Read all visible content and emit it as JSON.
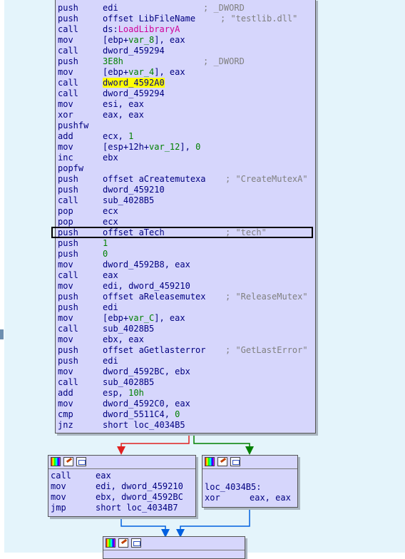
{
  "main_block": {
    "lines": [
      {
        "mn": "push",
        "op": "edi",
        "cm": "; _DWORD",
        "cmx": "cm1"
      },
      {
        "mn": "push",
        "op": "offset LibFileName",
        "cm": "; \"testlib.dll\"",
        "cmx": "cm2"
      },
      {
        "mn": "call",
        "op": "ds:",
        "op_mag": "LoadLibraryA"
      },
      {
        "mn": "mov",
        "op": "[ebp+",
        "op_green": "var_8",
        "op_tail": "], eax"
      },
      {
        "mn": "call",
        "op": "dword_459294"
      },
      {
        "mn": "push",
        "op_green_full": "3E8h",
        "cm": "; _DWORD",
        "cmx": "cm1"
      },
      {
        "mn": "mov",
        "op": "[ebp+",
        "op_green": "var_4",
        "op_tail": "], eax"
      },
      {
        "mn": "call",
        "op_hl": "dword_4592A0"
      },
      {
        "mn": "call",
        "op": "dword_459294"
      },
      {
        "mn": "mov",
        "op": "esi, eax"
      },
      {
        "mn": "xor",
        "op": "eax, eax"
      },
      {
        "mn": "pushfw",
        "op": ""
      },
      {
        "mn": "add",
        "op": "ecx, ",
        "op_green2": "1"
      },
      {
        "mn": "mov",
        "op": "[esp+12h+",
        "op_green": "var_12",
        "op_tail": "], ",
        "op_green3": "0"
      },
      {
        "mn": "inc",
        "op": "ebx"
      },
      {
        "mn": "popfw",
        "op": ""
      },
      {
        "mn": "push",
        "op": "offset aCreatemutexa",
        "cm": "; \"CreateMutexA\"",
        "cmx": "cm3"
      },
      {
        "mn": "push",
        "op": "dword_459210"
      },
      {
        "mn": "call",
        "op": "sub_4028B5"
      },
      {
        "mn": "pop",
        "op": "ecx"
      },
      {
        "mn": "pop",
        "op": "ecx"
      },
      {
        "mn": "push",
        "op": "offset aTech",
        "cm": "; \"tech\"",
        "cmx": "cm4"
      },
      {
        "mn": "push",
        "op_green_full": "1"
      },
      {
        "mn": "push",
        "op_green_full": "0"
      },
      {
        "mn": "mov",
        "op": "dword_4592B8, eax"
      },
      {
        "mn": "call",
        "op": "eax"
      },
      {
        "mn": "mov",
        "op": "edi, dword_459210"
      },
      {
        "mn": "push",
        "op": "offset aReleasemutex",
        "cm": "; \"ReleaseMutex\"",
        "cmx": "cm3"
      },
      {
        "mn": "push",
        "op": "edi"
      },
      {
        "mn": "mov",
        "op": "[ebp+",
        "op_green": "var_C",
        "op_tail": "], eax"
      },
      {
        "mn": "call",
        "op": "sub_4028B5"
      },
      {
        "mn": "mov",
        "op": "ebx, eax"
      },
      {
        "mn": "push",
        "op": "offset aGetlasterror",
        "cm": "; \"GetLastError\"",
        "cmx": "cm3"
      },
      {
        "mn": "push",
        "op": "edi"
      },
      {
        "mn": "mov",
        "op": "dword_4592BC, ebx"
      },
      {
        "mn": "call",
        "op": "sub_4028B5"
      },
      {
        "mn": "add",
        "op": "esp, ",
        "op_green2": "10h"
      },
      {
        "mn": "mov",
        "op": "dword_4592C0, eax"
      },
      {
        "mn": "cmp",
        "op": "dword_5511C4, ",
        "op_green3": "0"
      },
      {
        "mn": "jnz",
        "op": "short loc_4034B5"
      }
    ]
  },
  "block_a": {
    "lines": [
      {
        "mn": "call",
        "op": "eax"
      },
      {
        "mn": "mov",
        "op": "edi, dword_459210"
      },
      {
        "mn": "mov",
        "op": "ebx, dword_4592BC"
      },
      {
        "mn": "jmp",
        "op": "short loc_4034B7"
      }
    ]
  },
  "block_b": {
    "label": "loc_4034B5:",
    "line": {
      "mn": "xor",
      "op": "eax, eax"
    }
  },
  "colors": {
    "block_bg": "#d6d6fc",
    "canvas_bg": "#e4f4fb",
    "mnemonic": "#000080",
    "immediate": "#008000",
    "import": "#d0009a",
    "highlight": "#ffff00",
    "edge_false": "#e02020",
    "edge_true": "#008000",
    "edge_jump": "#0060e0"
  },
  "icons": [
    "graph-color-icon",
    "edit-node-icon",
    "node-window-icon"
  ]
}
